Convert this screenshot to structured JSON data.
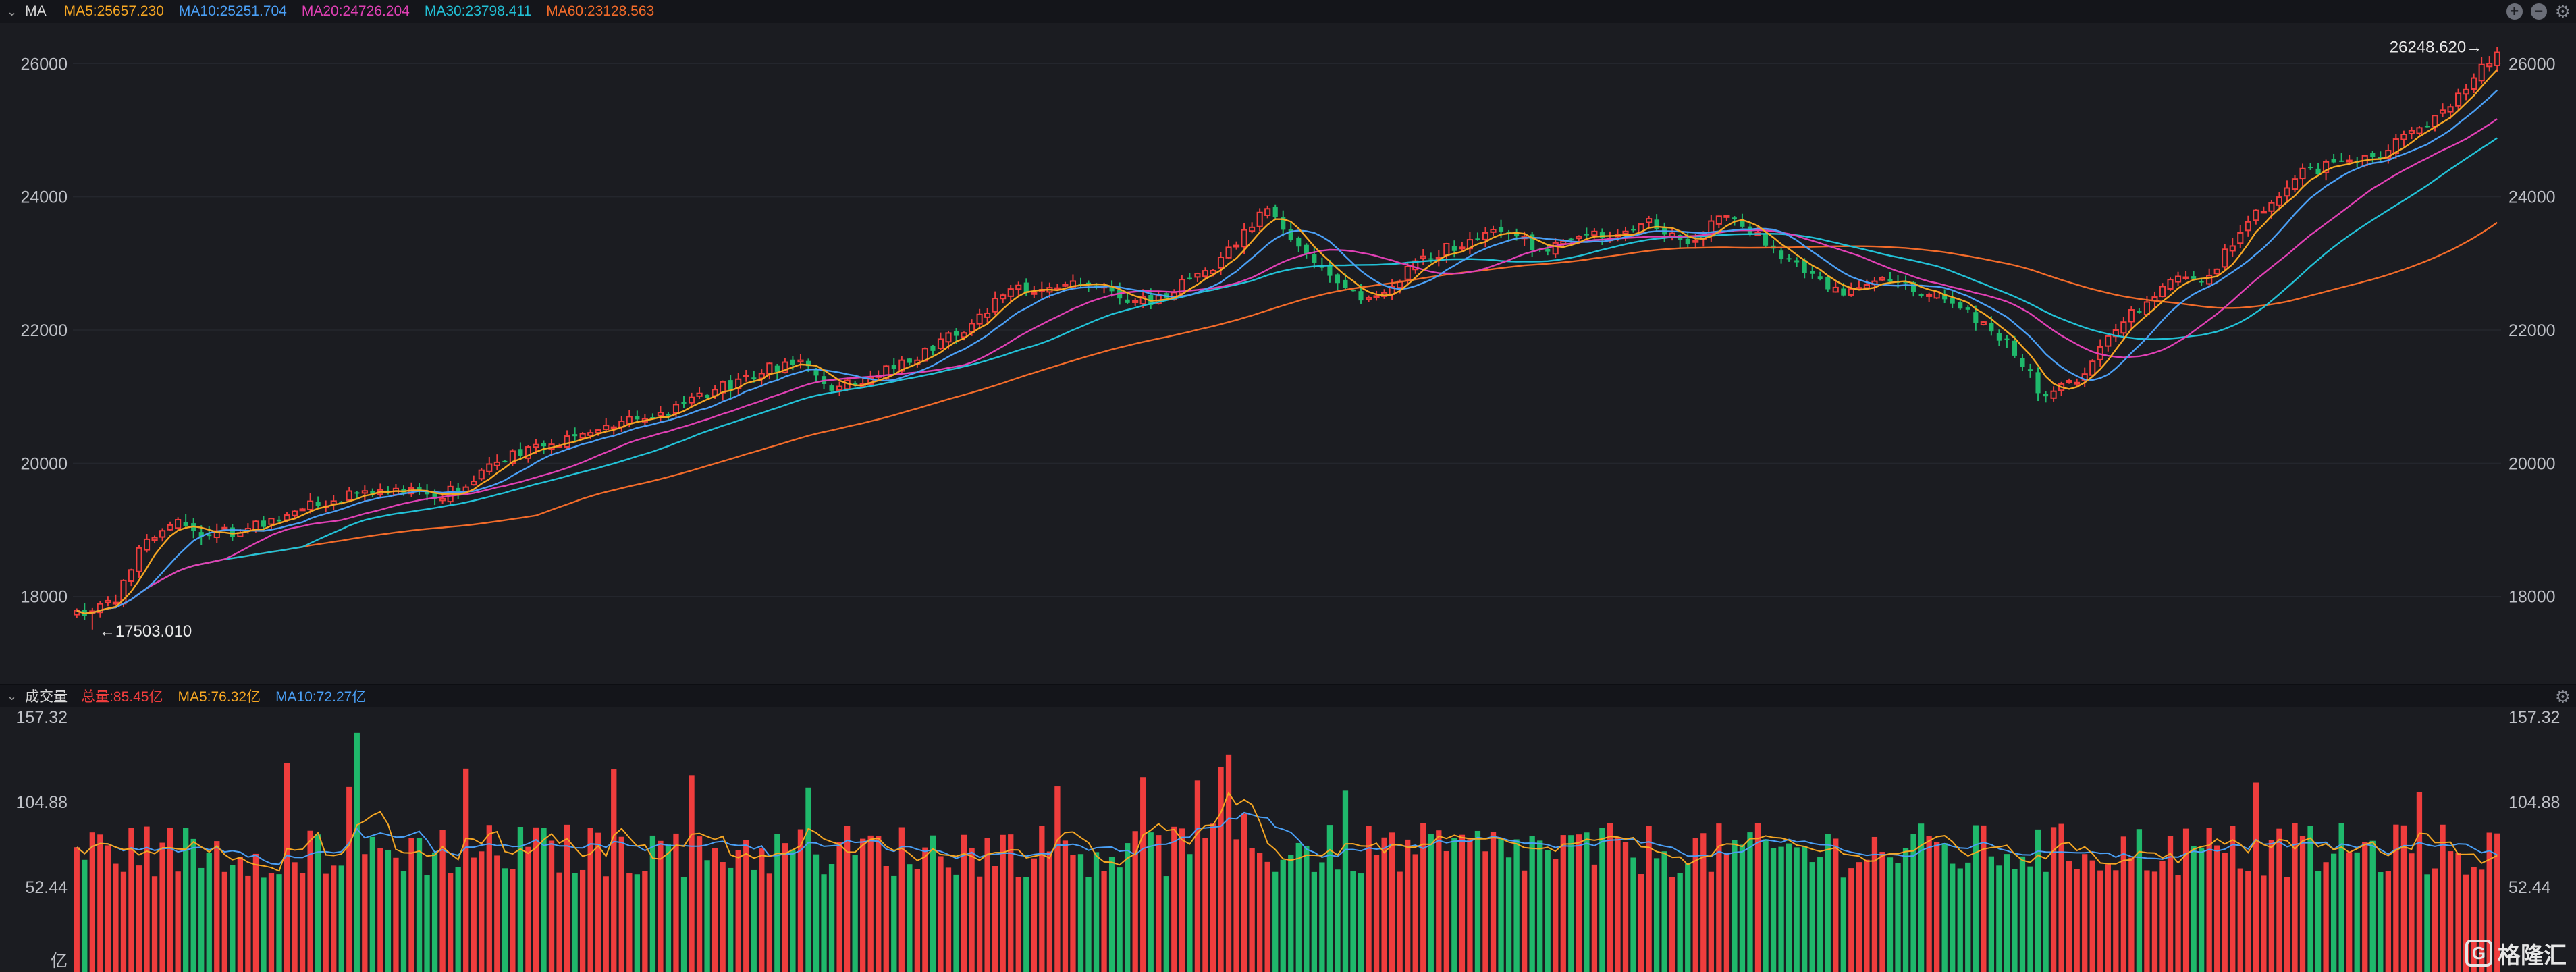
{
  "legend_top": {
    "title": "MA",
    "items": [
      {
        "label": "MA5:25657.230",
        "color": "#f5a623"
      },
      {
        "label": "MA10:25251.704",
        "color": "#4a9ff5"
      },
      {
        "label": "MA20:24726.204",
        "color": "#e040b4"
      },
      {
        "label": "MA30:23798.411",
        "color": "#22c1d6"
      },
      {
        "label": "MA60:23128.563",
        "color": "#f26b2a"
      }
    ]
  },
  "legend_volume": {
    "title": "成交量",
    "items": [
      {
        "label": "总量:85.45亿",
        "color": "#ef3d3d"
      },
      {
        "label": "MA5:76.32亿",
        "color": "#f5a623"
      },
      {
        "label": "MA10:72.27亿",
        "color": "#4a9ff5"
      }
    ]
  },
  "annotations": {
    "high": "26248.620",
    "low": "17503.010",
    "volume_unit": "亿"
  },
  "logo_text": "格隆汇",
  "icons": [
    "plus-circle-icon",
    "minus-circle-icon",
    "gear-icon"
  ],
  "chart_data": [
    {
      "type": "candlestick",
      "name": "price",
      "y_ticks": [
        18000,
        20000,
        22000,
        24000,
        26000
      ],
      "ylim": [
        16700,
        26550
      ],
      "bars": 240,
      "high": 26248.62,
      "low": 17503.01,
      "close_anchors": [
        [
          0,
          17700
        ],
        [
          5,
          17950
        ],
        [
          8,
          18700
        ],
        [
          12,
          19150
        ],
        [
          16,
          18900
        ],
        [
          22,
          19000
        ],
        [
          30,
          19400
        ],
        [
          40,
          19600
        ],
        [
          47,
          19500
        ],
        [
          55,
          20100
        ],
        [
          62,
          20350
        ],
        [
          75,
          20750
        ],
        [
          80,
          21000
        ],
        [
          86,
          21300
        ],
        [
          92,
          21550
        ],
        [
          97,
          21100
        ],
        [
          104,
          21400
        ],
        [
          112,
          21900
        ],
        [
          120,
          22600
        ],
        [
          128,
          22750
        ],
        [
          137,
          22400
        ],
        [
          145,
          22900
        ],
        [
          152,
          23800
        ],
        [
          158,
          23100
        ],
        [
          165,
          22400
        ],
        [
          168,
          22700
        ],
        [
          173,
          23100
        ],
        [
          182,
          23500
        ],
        [
          188,
          23200
        ],
        [
          194,
          23400
        ],
        [
          202,
          23600
        ],
        [
          206,
          23300
        ],
        [
          212,
          23750
        ],
        [
          218,
          23100
        ],
        [
          226,
          22550
        ],
        [
          232,
          22800
        ],
        [
          238,
          22500
        ],
        [
          242,
          22300
        ],
        [
          248,
          21700
        ],
        [
          252,
          21000
        ],
        [
          256,
          21200
        ],
        [
          262,
          22100
        ],
        [
          268,
          22800
        ],
        [
          272,
          22650
        ],
        [
          278,
          23600
        ],
        [
          284,
          24300
        ],
        [
          290,
          24500
        ],
        [
          296,
          24700
        ],
        [
          302,
          25200
        ],
        [
          308,
          25900
        ],
        [
          310,
          26200
        ]
      ],
      "ma_colors": {
        "MA5": "#f5a623",
        "MA10": "#4a9ff5",
        "MA20": "#e040b4",
        "MA30": "#22c1d6",
        "MA60": "#f26b2a"
      }
    },
    {
      "type": "bar",
      "name": "volume",
      "y_ticks": [
        52.44,
        104.88,
        157.32
      ],
      "ylim": [
        0,
        157.32
      ],
      "unit": "亿",
      "last_value": 85.45,
      "ma5_last": 76.32,
      "ma10_last": 72.27
    }
  ]
}
